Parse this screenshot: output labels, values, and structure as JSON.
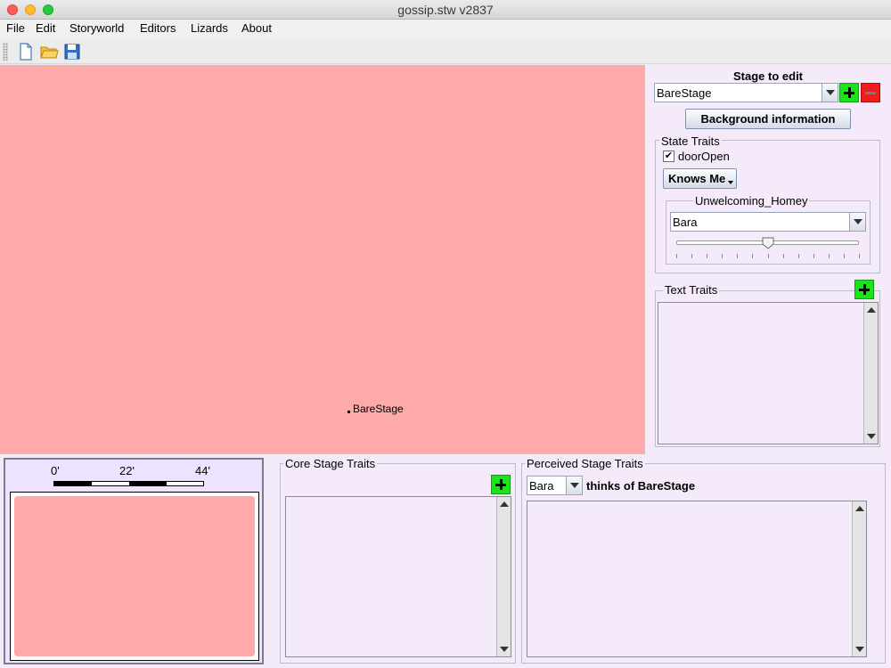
{
  "window": {
    "title": "gossip.stw v2837"
  },
  "menubar": {
    "items": [
      "File",
      "Edit",
      "Storyworld",
      "Editors",
      "Lizards",
      "About"
    ]
  },
  "toolbar": {
    "icons": [
      "new-file-icon",
      "open-folder-icon",
      "save-icon"
    ]
  },
  "canvas": {
    "stage_label": "BareStage",
    "background_color": "#ffaaaa"
  },
  "right_panel": {
    "stage_to_edit_label": "Stage to edit",
    "stage_select_value": "BareStage",
    "background_button": "Background information",
    "state_traits": {
      "title": "State Traits",
      "checkbox_label": "doorOpen",
      "checkbox_checked": true,
      "knows_me_button": "Knows Me",
      "trait_group_title": "Unwelcoming_Homey",
      "actor_select_value": "Bara",
      "slider_value": 0.5
    },
    "text_traits": {
      "title": "Text Traits"
    }
  },
  "bottom": {
    "scale": {
      "ticks": [
        "0'",
        "22'",
        "44'"
      ]
    },
    "core_stage_traits": {
      "title": "Core Stage Traits"
    },
    "perceived_stage_traits": {
      "title": "Perceived Stage Traits",
      "actor_select_value": "Bara",
      "thinks_of_text": "thinks of BareStage"
    }
  },
  "colors": {
    "add_button": "#1de21d",
    "remove_button": "#ee1c1c",
    "panel_bg": "#f5eaf9"
  }
}
